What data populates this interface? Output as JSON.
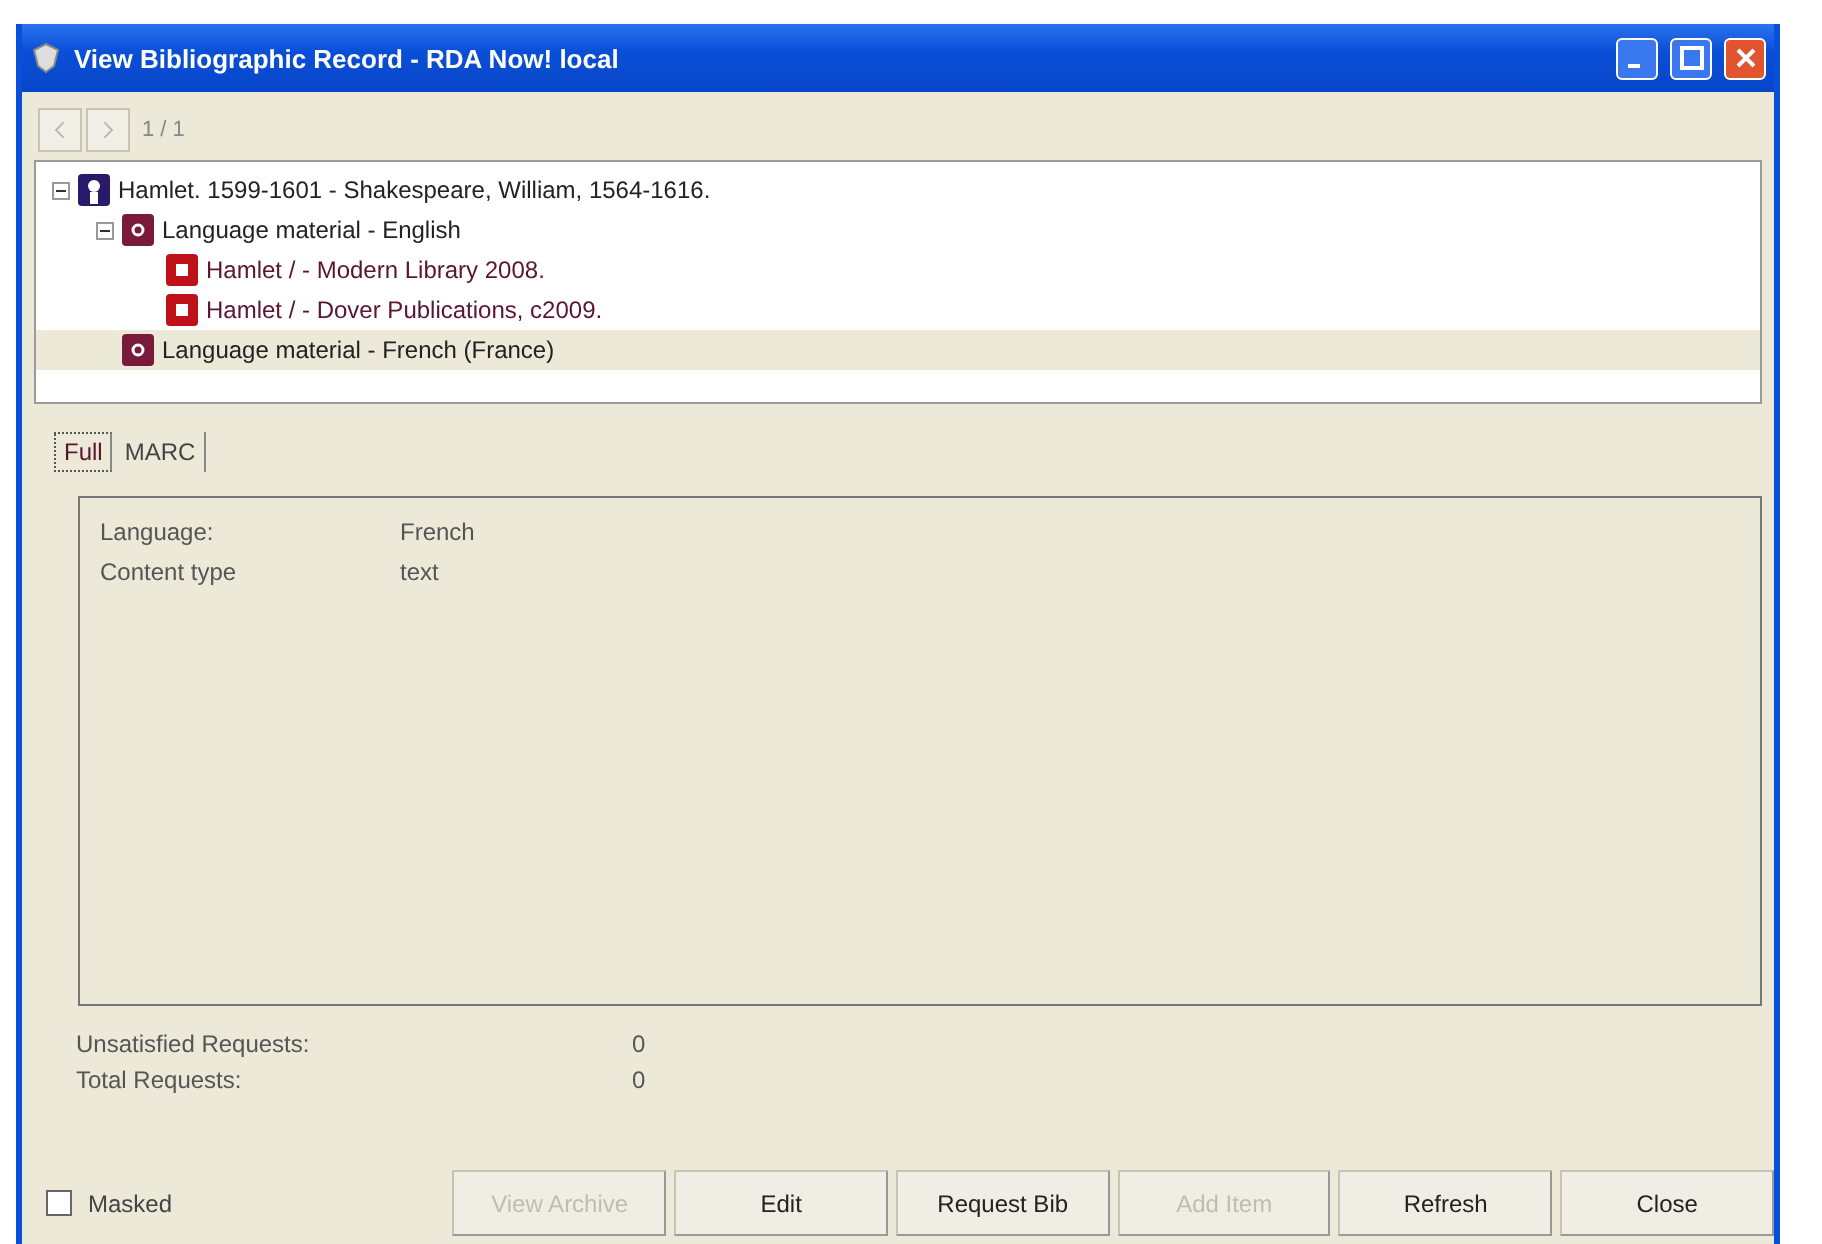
{
  "window": {
    "title": "View Bibliographic Record - RDA Now! local"
  },
  "navigation": {
    "counter": "1 / 1"
  },
  "tree": [
    {
      "label": "Hamlet. 1599-1601 - Shakespeare, William, 1564-1616.",
      "kind": "work",
      "expanded": true,
      "selected": false,
      "children": [
        {
          "label": "Language material - English",
          "kind": "expression",
          "expanded": true,
          "selected": false,
          "children": [
            {
              "label": "Hamlet / - Modern Library 2008.",
              "kind": "manifestation",
              "selected": false
            },
            {
              "label": "Hamlet / - Dover Publications, c2009.",
              "kind": "manifestation",
              "selected": false
            }
          ]
        },
        {
          "label": "Language material - French (France)",
          "kind": "expression",
          "selected": true
        }
      ]
    }
  ],
  "tabs": [
    {
      "label": "Full",
      "selected": true
    },
    {
      "label": "MARC",
      "selected": false
    }
  ],
  "details": [
    {
      "label": "Language:",
      "value": "French"
    },
    {
      "label": "Content type",
      "value": "text"
    }
  ],
  "requests": [
    {
      "label": "Unsatisfied Requests:",
      "value": "0"
    },
    {
      "label": "Total Requests:",
      "value": "0"
    }
  ],
  "masked": {
    "label": "Masked",
    "checked": false
  },
  "buttons": [
    {
      "label": "View Archive",
      "disabled": true
    },
    {
      "label": "Edit",
      "disabled": false
    },
    {
      "label": "Request Bib",
      "disabled": false
    },
    {
      "label": "Add Item",
      "disabled": true
    },
    {
      "label": "Refresh",
      "disabled": false
    },
    {
      "label": "Close",
      "disabled": false
    }
  ]
}
